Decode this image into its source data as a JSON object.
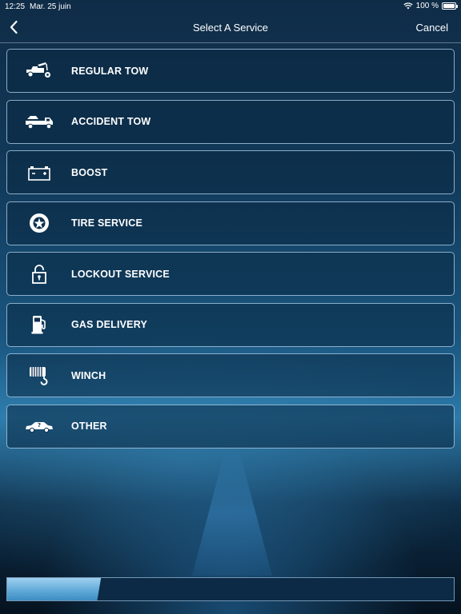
{
  "status_bar": {
    "time": "12:25",
    "date": "Mar. 25 juin",
    "battery": "100 %",
    "wifi_icon": "wifi-icon",
    "battery_icon": "battery-icon"
  },
  "nav": {
    "title": "Select A Service",
    "cancel_label": "Cancel",
    "back_icon": "chevron-left-icon"
  },
  "services": [
    {
      "label": "REGULAR TOW",
      "icon": "tow-truck-icon"
    },
    {
      "label": "ACCIDENT TOW",
      "icon": "flatbed-truck-icon"
    },
    {
      "label": "BOOST",
      "icon": "battery-boost-icon"
    },
    {
      "label": "TIRE SERVICE",
      "icon": "tire-icon"
    },
    {
      "label": "LOCKOUT SERVICE",
      "icon": "unlock-icon"
    },
    {
      "label": "GAS DELIVERY",
      "icon": "gas-pump-icon"
    },
    {
      "label": "WINCH",
      "icon": "winch-icon"
    },
    {
      "label": "OTHER",
      "icon": "car-question-icon"
    }
  ],
  "progress": {
    "value": 0.21
  },
  "colors": {
    "background": "#123b5c",
    "card_border": "#b4d7f0",
    "progress_fill": "#5da7d6"
  }
}
